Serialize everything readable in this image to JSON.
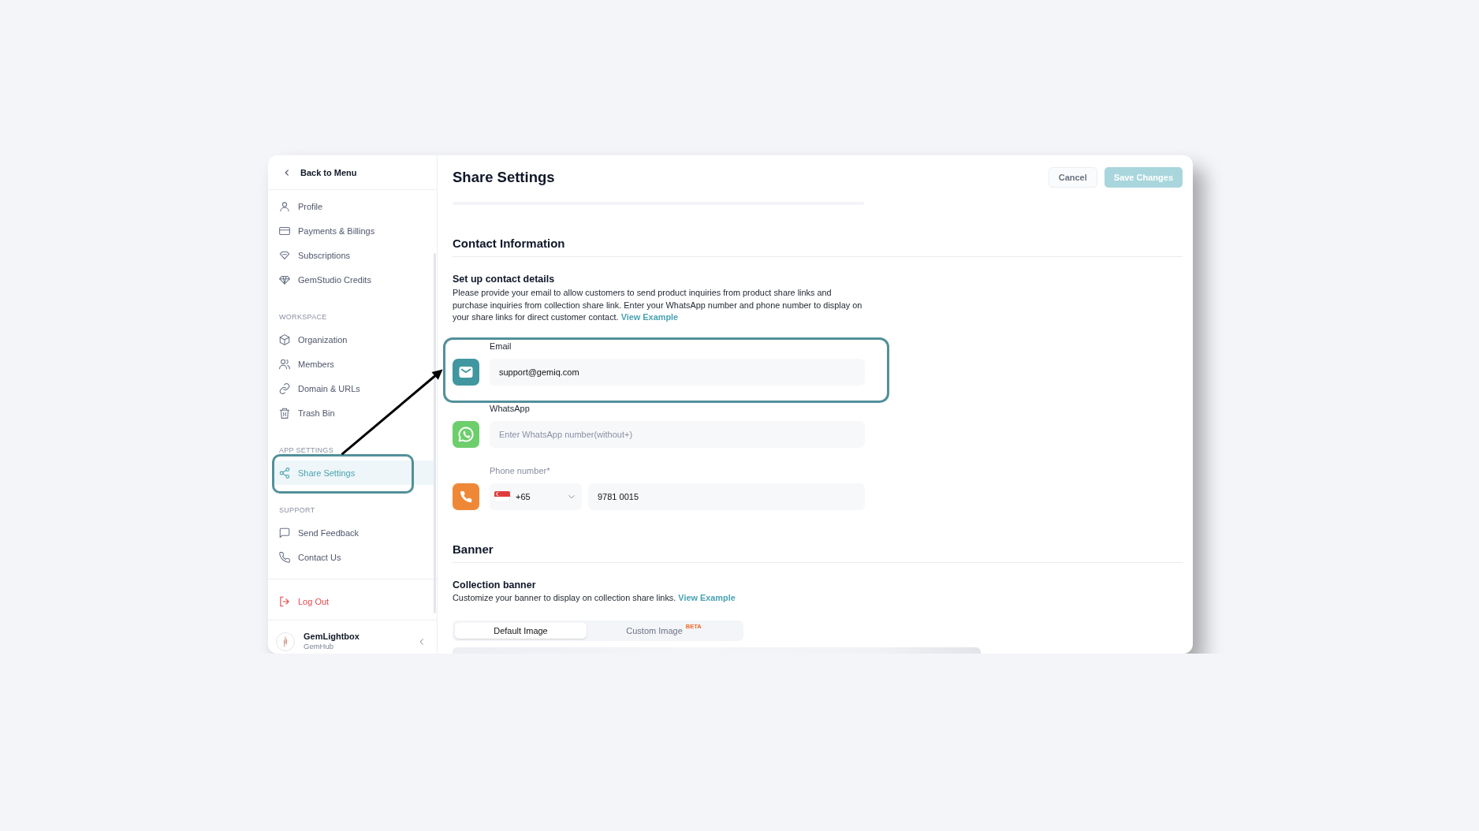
{
  "sidebar": {
    "back": {
      "label": "Back to Menu"
    },
    "sections": [
      {
        "items": [
          {
            "label": "Profile",
            "selected": false,
            "callout": false
          },
          {
            "label": "Payments & Billings",
            "selected": false,
            "callout": false
          },
          {
            "label": "Subscriptions",
            "selected": false,
            "callout": false
          },
          {
            "label": "GemStudio Credits",
            "selected": false,
            "callout": false
          }
        ]
      },
      {
        "heading": "WORKSPACE",
        "items": [
          {
            "label": "Organization",
            "selected": false,
            "callout": false
          },
          {
            "label": "Members",
            "selected": false,
            "callout": false
          },
          {
            "label": "Domain & URLs",
            "selected": false,
            "callout": false
          },
          {
            "label": "Trash Bin",
            "selected": false,
            "callout": false
          }
        ]
      },
      {
        "heading": "APP SETTINGS",
        "items": [
          {
            "label": "Share Settings",
            "selected": true,
            "callout": true
          }
        ]
      },
      {
        "heading": "SUPPORT",
        "items": [
          {
            "label": "Send Feedback",
            "selected": false,
            "callout": false
          },
          {
            "label": "Contact Us",
            "selected": false,
            "callout": false
          }
        ]
      }
    ],
    "logout": {
      "label": "Log Out"
    },
    "account": {
      "name": "GemLightbox",
      "workspace": "GemHub"
    }
  },
  "header": {
    "title": "Share Settings",
    "buttons": [
      {
        "label": "Cancel",
        "kind": "secondary",
        "disabled": false
      },
      {
        "label": "Save Changes",
        "kind": "primary",
        "disabled": true
      }
    ]
  },
  "contact": {
    "heading": "Contact Information",
    "subheading": "Set up contact details",
    "description": "Please provide your email to allow customers to send product inquiries from product share links and purchase inquiries from collection share link. Enter your WhatsApp number and phone number to display on your share links for direct customer contact.",
    "link": "View Example",
    "fields": [
      {
        "kind": "email",
        "label": "Email",
        "value": "support@gemiq.com",
        "callout": true
      },
      {
        "kind": "whatsapp",
        "label": "WhatsApp",
        "placeholder": "Enter WhatsApp number(without+)",
        "callout": false
      },
      {
        "kind": "phone",
        "label": "Phone number*",
        "country_code": "+65",
        "value": "9781 0015",
        "callout": false
      }
    ]
  },
  "banner": {
    "heading": "Banner",
    "subheading": "Collection banner",
    "description": "Customize your banner to display on collection share links.",
    "link": "View Example",
    "tabs": [
      {
        "label": "Default Image",
        "selected": true
      },
      {
        "label": "Custom Image",
        "badge": "BETA",
        "selected": false
      }
    ]
  }
}
